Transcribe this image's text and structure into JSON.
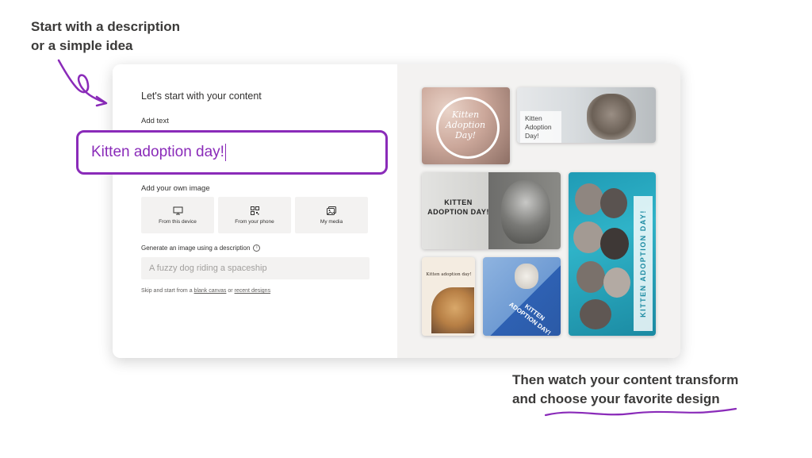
{
  "callouts": {
    "top_line1": "Start with a description",
    "top_line2": "or a simple idea",
    "bottom_line1": "Then watch your content transform",
    "bottom_line2": "and choose your favorite design"
  },
  "colors": {
    "accent": "#8a2bb9",
    "panel": "#f3f2f1",
    "text": "#323130"
  },
  "form": {
    "heading": "Let's start with your content",
    "add_text_label": "Add text",
    "text_value": "Kitten adoption day!",
    "own_image_label": "Add your own image",
    "tiles": [
      {
        "label": "From this device",
        "icon": "monitor-icon"
      },
      {
        "label": "From your phone",
        "icon": "qr-code-icon"
      },
      {
        "label": "My media",
        "icon": "media-icon"
      }
    ],
    "generate_label": "Generate an image using a description",
    "generate_placeholder": "A fuzzy dog riding a spaceship",
    "skip_prefix": "Skip and start from a",
    "skip_link1": "blank canvas",
    "skip_or": "or",
    "skip_link2": "recent designs"
  },
  "designs": [
    {
      "title": "Kitten Adoption Day!",
      "style": "script-circle"
    },
    {
      "title": "Kitten Adoption Day!",
      "style": "left-text-banner"
    },
    {
      "title": "KITTEN ADOPTION DAY!",
      "style": "bold-split"
    },
    {
      "title": "KITTEN ADOPTION DAY!",
      "style": "vertical-teal"
    },
    {
      "title": "Kitten adoption day!",
      "style": "serif-card"
    },
    {
      "title": "KITTEN ADOPTION DAY!",
      "style": "blue-diagonal"
    }
  ]
}
